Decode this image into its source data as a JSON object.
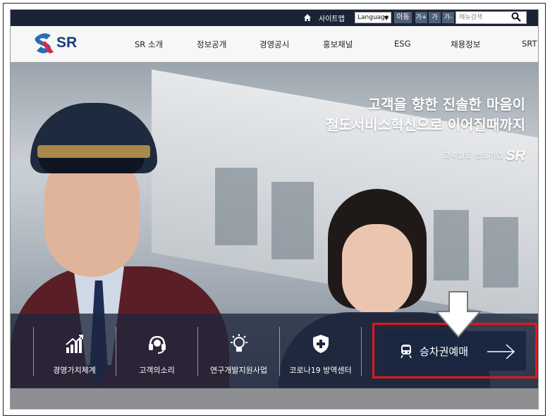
{
  "topbar": {
    "sitemap": "사이트맵",
    "language": "Language",
    "go": "이동",
    "font_large": "가+",
    "font_normal": "가",
    "font_small": "가-",
    "search_placeholder": "메뉴검색"
  },
  "header": {
    "logo_text": "SR",
    "nav": [
      "SR 소개",
      "정보공개",
      "경영공시",
      "홍보채널",
      "ESG",
      "채용정보",
      "SRT"
    ]
  },
  "hero": {
    "slogan_line1": "고객을 향한 진솔한 마음이",
    "slogan_line2": "철도서비스혁신으로 이어질때까지",
    "brand_prefix": "고속철도 선도기업",
    "brand_logo": "SR"
  },
  "quicklinks": [
    {
      "label": "경영가치체계",
      "icon": "chart-growth-icon"
    },
    {
      "label": "고객의소리",
      "icon": "headset-icon"
    },
    {
      "label": "연구개발지원사업",
      "icon": "lightbulb-icon"
    },
    {
      "label": "코로나19 방역센터",
      "icon": "medical-shield-icon"
    }
  ],
  "ticket": {
    "label": "승차권예매",
    "icon": "train-icon"
  },
  "colors": {
    "topbar_bg": "#1b2436",
    "highlight": "#e3171e",
    "quickbar_bg": "#1e263c"
  }
}
